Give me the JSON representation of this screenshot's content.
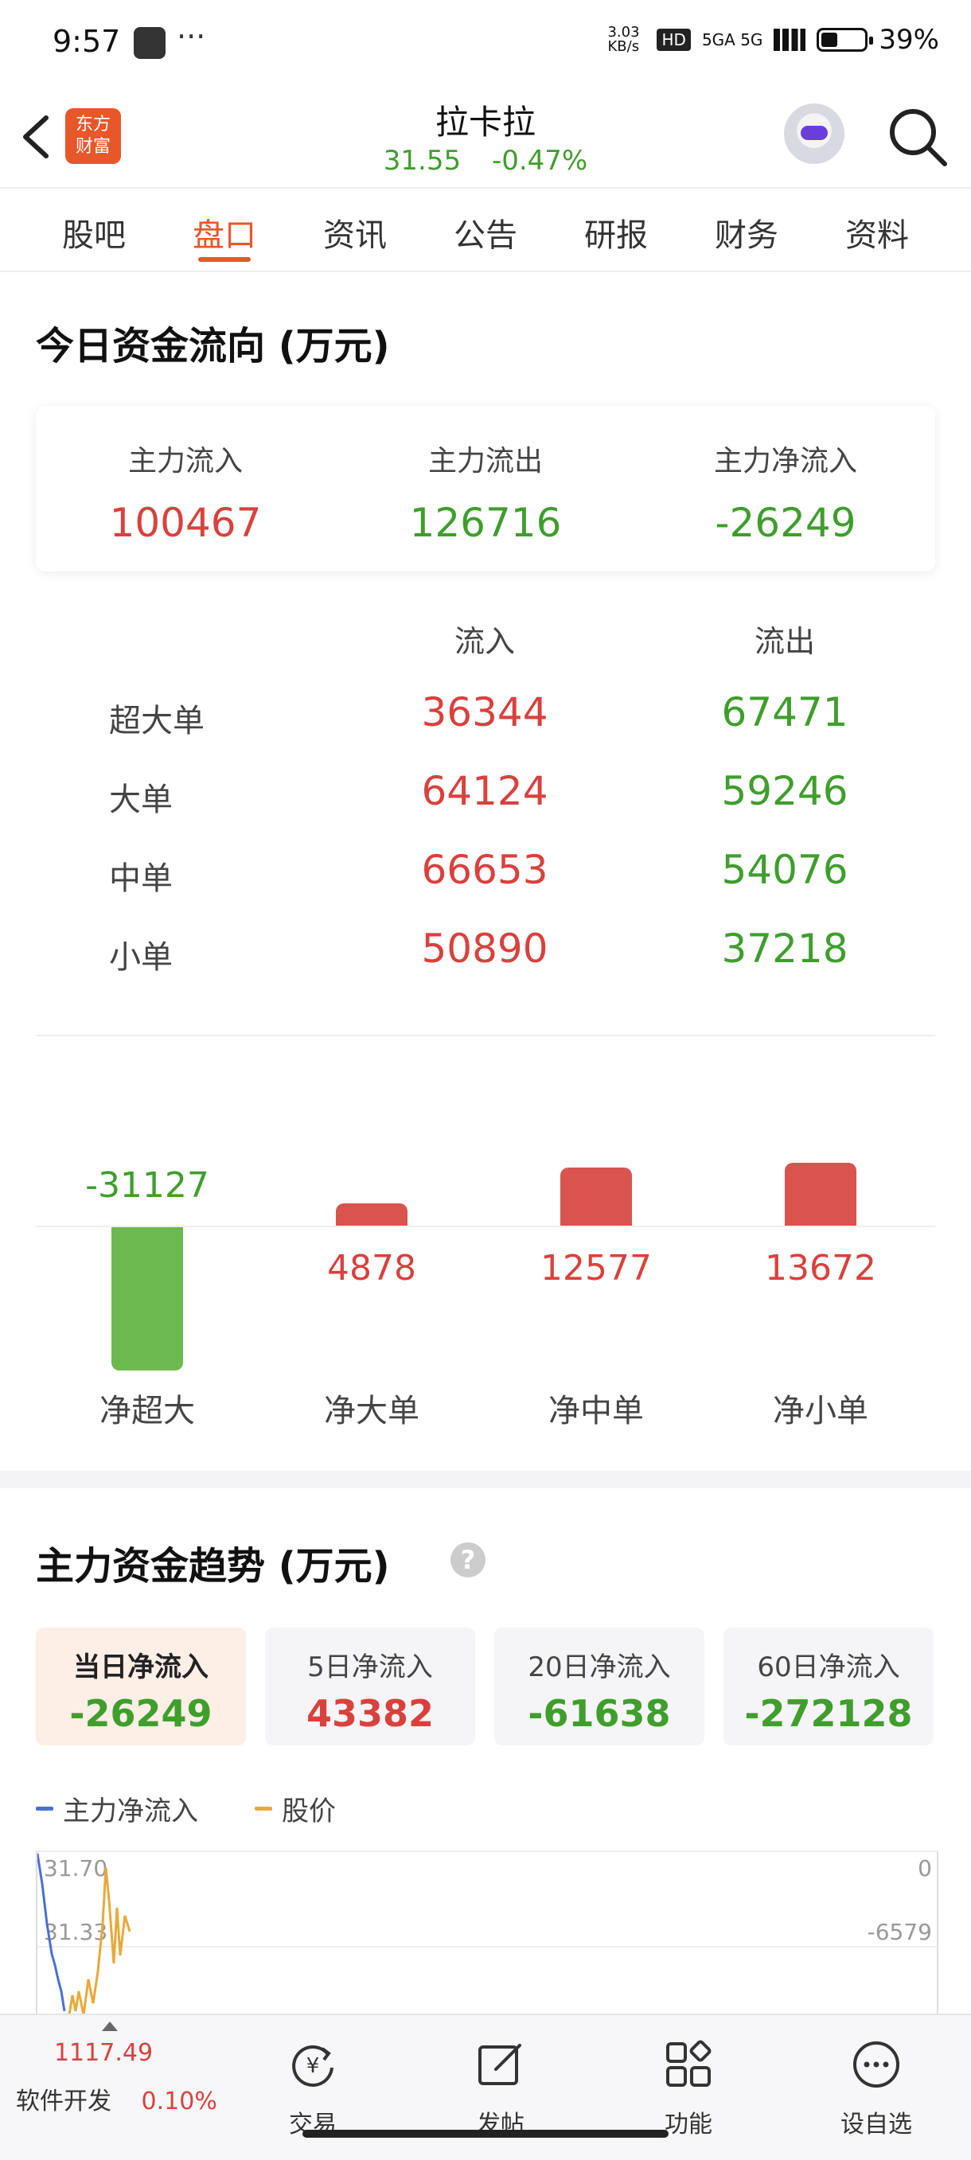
{
  "status_bar": {
    "time": "9:57",
    "dots": "···",
    "speed": "3.03 KB/s",
    "network": "5GA 5G",
    "battery_pct": 39,
    "battery": "39%"
  },
  "header": {
    "logo_line1": "东方",
    "logo_line2": "财富",
    "stock_name": "拉卡拉",
    "price": "31.55",
    "change": "-0.47%"
  },
  "tabs": [
    {
      "label": "股吧"
    },
    {
      "label": "盘口"
    },
    {
      "label": "资讯"
    },
    {
      "label": "公告"
    },
    {
      "label": "研报"
    },
    {
      "label": "财务"
    },
    {
      "label": "资料"
    }
  ],
  "fund_flow": {
    "title": "今日资金流向 (万元)",
    "summary": [
      {
        "label": "主力流入",
        "value": "100467"
      },
      {
        "label": "主力流出",
        "value": "126716"
      },
      {
        "label": "主力净流入",
        "value": "-26249"
      }
    ],
    "col_in": "流入",
    "col_out": "流出",
    "rows": [
      {
        "label": "超大单",
        "in": "36344",
        "out": "67471"
      },
      {
        "label": "大单",
        "in": "64124",
        "out": "59246"
      },
      {
        "label": "中单",
        "in": "66653",
        "out": "54076"
      },
      {
        "label": "小单",
        "in": "50890",
        "out": "37218"
      }
    ]
  },
  "chart_data": {
    "type": "bar",
    "categories": [
      "净超大",
      "净大单",
      "净中单",
      "净小单"
    ],
    "values": [
      -31127,
      4878,
      12577,
      13672
    ],
    "value_labels": [
      "-31127",
      "4878",
      "12577",
      "13672"
    ],
    "colors": {
      "positive": "#d9534f",
      "negative": "#6cb94f"
    }
  },
  "trend": {
    "title": "主力资金趋势 (万元)",
    "help_icon": "question-circle-icon",
    "periods": [
      {
        "label": "当日净流入",
        "value": "-26249"
      },
      {
        "label": "5日净流入",
        "value": "43382"
      },
      {
        "label": "20日净流入",
        "value": "-61638"
      },
      {
        "label": "60日净流入",
        "value": "-272128"
      }
    ],
    "legend": [
      {
        "name": "主力净流入",
        "color": "#4a6fd8"
      },
      {
        "name": "股价",
        "color": "#e8a93a"
      }
    ],
    "y_left": [
      "31.70",
      "31.33"
    ],
    "y_right": [
      "0",
      "-6579"
    ]
  },
  "bottom_nav": {
    "index_value": "1117.49",
    "index_name": "软件开发",
    "index_change": "0.10%",
    "items": [
      {
        "label": "交易",
        "icon": "trade-yen-icon"
      },
      {
        "label": "发帖",
        "icon": "compose-icon"
      },
      {
        "label": "功能",
        "icon": "grid-icon"
      },
      {
        "label": "设自选",
        "icon": "more-circle-icon"
      }
    ]
  },
  "colors": {
    "accent": "#e8572a",
    "up": "#d9413d",
    "down": "#3f9e2c"
  }
}
